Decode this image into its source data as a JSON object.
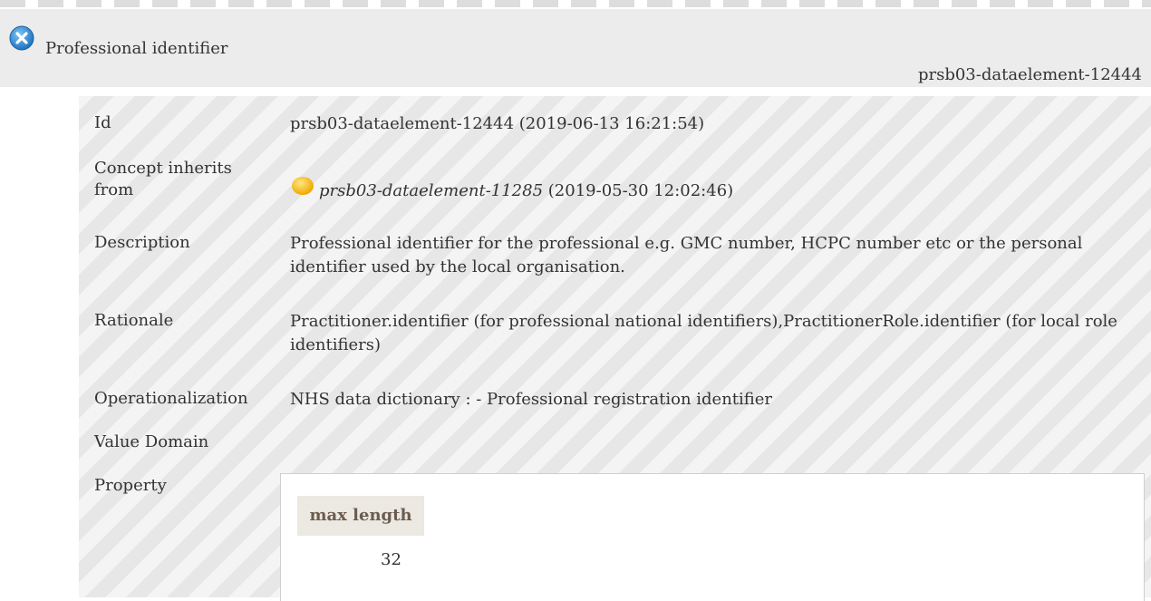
{
  "header": {
    "title": "Professional identifier",
    "id": "prsb03-dataelement-12444",
    "close_icon": "close-circle-icon",
    "accent_color": "#2f8fd6"
  },
  "details": {
    "id_label": "Id",
    "id_value": "prsb03-dataelement-12444 (2019-06-13 16:21:54)",
    "inherits_label": "Concept inherits from",
    "inherits_icon": "status-dot-icon",
    "inherits_icon_color": "#f5b800",
    "inherits_link": "prsb03-dataelement-11285",
    "inherits_date": "(2019-05-30 12:02:46)",
    "description_label": "Description",
    "description_value": "Professional identifier for the professional e.g. GMC number, HCPC number etc or the personal identifier used by the local organisation.",
    "rationale_label": "Rationale",
    "rationale_value": "Practitioner.identifier (for professional national identifiers),PractitionerRole.identifier (for local role identifiers)",
    "operationalization_label": "Operationalization",
    "operationalization_value": "NHS data dictionary : - Professional registration identifier",
    "value_domain_label": "Value Domain",
    "property_label": "Property"
  },
  "property_table": {
    "header": "max length",
    "value": "32"
  }
}
